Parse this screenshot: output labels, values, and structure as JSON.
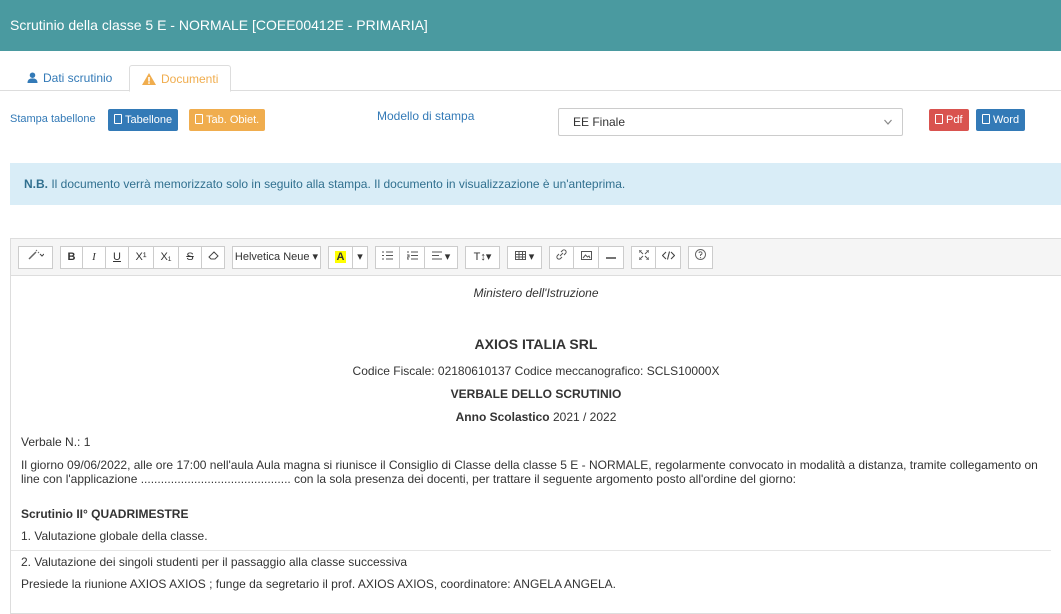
{
  "header": {
    "title": "Scrutinio della classe 5 E - NORMALE [COEE00412E - PRIMARIA]"
  },
  "tabs": [
    {
      "label": "Dati scrutinio",
      "icon": "user-icon"
    },
    {
      "label": "Documenti",
      "icon": "warning-icon",
      "active": true
    }
  ],
  "print": {
    "label": "Stampa tabellone",
    "tabellone": "Tabellone",
    "tab_obiet": "Tab. Obiet.",
    "modello_label": "Modello di stampa",
    "modello_value": "EE Finale",
    "pdf": "Pdf",
    "word": "Word"
  },
  "notice": {
    "bold": "N.B.",
    "text": " Il documento verrà memorizzato solo in seguito alla stampa. Il documento in visualizzazione è un'anteprima."
  },
  "toolbar": {
    "font_name": "Helvetica Neue",
    "bold": "B",
    "italic": "I",
    "underline": "U",
    "superscript": "X¹",
    "subscript": "X₁",
    "font_size": "T↕"
  },
  "document": {
    "ministero": "Ministero dell'Istruzione",
    "school": "AXIOS ITALIA SRL",
    "codes": "Codice Fiscale: 02180610137 Codice meccanografico: SCLS10000X",
    "verbale_title": "VERBALE DELLO SCRUTINIO",
    "anno_label": "Anno Scolastico",
    "anno_value": " 2021 / 2022",
    "verbale_num": "Verbale N.: 1",
    "paragraph": "Il giorno 09/06/2022, alle ore 17:00 nell'aula Aula magna si riunisce il Consiglio di Classe della classe 5 E - NORMALE, regolarmente convocato in modalità a distanza, tramite collegamento on line con l'applicazione ............................................. con la sola presenza dei docenti, per trattare il seguente argomento posto all'ordine del giorno:",
    "scrutinio_heading": "Scrutinio II° QUADRIMESTRE",
    "item1": "1. Valutazione globale della classe.",
    "item2": "2. Valutazione dei singoli studenti per il passaggio alla classe successiva",
    "presiede": "Presiede la riunione AXIOS AXIOS ; funge da segretario il prof. AXIOS AXIOS, coordinatore: ANGELA ANGELA."
  }
}
